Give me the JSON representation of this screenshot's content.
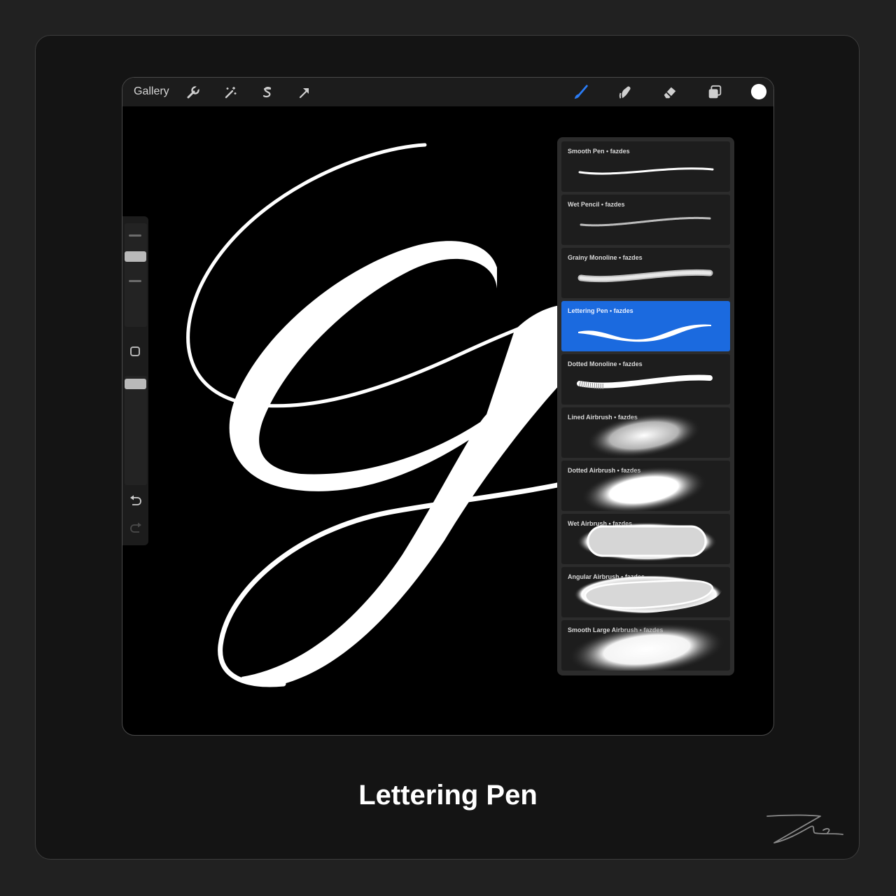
{
  "topbar": {
    "gallery_label": "Gallery",
    "left_tools": [
      "wrench-icon",
      "magic-wand-icon",
      "selection-icon",
      "transform-arrow-icon"
    ],
    "right_tools": [
      "brush-icon",
      "smudge-icon",
      "eraser-icon",
      "layers-icon",
      "color-swatch"
    ],
    "active_tool": "brush-icon",
    "active_color": "#2a7cf6",
    "current_color": "#ffffff"
  },
  "sidebar": {
    "tools": [
      "brush-size-slider",
      "modify-button",
      "opacity-slider",
      "undo-icon",
      "redo-icon"
    ]
  },
  "brush_library": {
    "selected_index": 3,
    "selected_color": "#1b6adf",
    "items": [
      {
        "name": "Smooth Pen",
        "author": "fazdes",
        "label": "Smooth Pen • fazdes"
      },
      {
        "name": "Wet Pencil",
        "author": "fazdes",
        "label": "Wet Pencil • fazdes"
      },
      {
        "name": "Grainy Monoline",
        "author": "fazdes",
        "label": "Grainy Monoline • fazdes"
      },
      {
        "name": "Lettering Pen",
        "author": "fazdes",
        "label": "Lettering Pen • fazdes"
      },
      {
        "name": "Dotted Monoline",
        "author": "fazdes",
        "label": "Dotted Monoline • fazdes"
      },
      {
        "name": "Lined Airbrush",
        "author": "fazdes",
        "label": "Lined Airbrush • fazdes"
      },
      {
        "name": "Dotted Airbrush",
        "author": "fazdes",
        "label": "Dotted Airbrush • fazdes"
      },
      {
        "name": "Wet Airbrush",
        "author": "fazdes",
        "label": "Wet Airbrush • fazdes"
      },
      {
        "name": "Angular Airbrush",
        "author": "fazdes",
        "label": "Angular Airbrush • fazdes"
      },
      {
        "name": "Smooth Large Airbrush",
        "author": "fazdes",
        "label": "Smooth Large Airbrush • fazdes"
      }
    ]
  },
  "caption": "Lettering Pen"
}
